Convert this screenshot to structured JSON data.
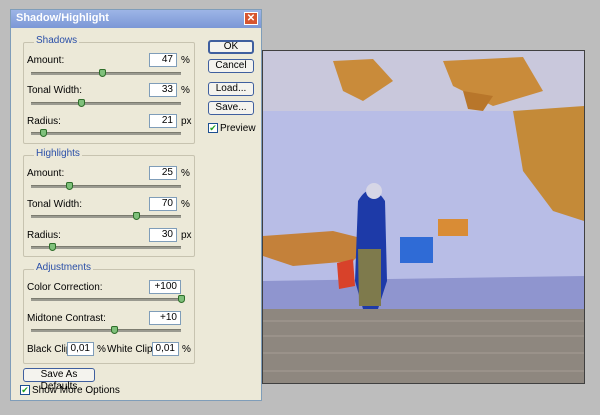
{
  "dialog": {
    "title": "Shadow/Highlight",
    "close_glyph": "✕"
  },
  "shadows": {
    "group_label": "Shadows",
    "amount": {
      "label": "Amount:",
      "value": "47",
      "unit": "%",
      "slider_fraction": 0.47
    },
    "tonal_width": {
      "label": "Tonal Width:",
      "value": "33",
      "unit": "%",
      "slider_fraction": 0.33
    },
    "radius": {
      "label": "Radius:",
      "value": "21",
      "unit": "px",
      "slider_fraction": 0.08
    }
  },
  "highlights": {
    "group_label": "Highlights",
    "amount": {
      "label": "Amount:",
      "value": "25",
      "unit": "%",
      "slider_fraction": 0.25
    },
    "tonal_width": {
      "label": "Tonal Width:",
      "value": "70",
      "unit": "%",
      "slider_fraction": 0.7
    },
    "radius": {
      "label": "Radius:",
      "value": "30",
      "unit": "px",
      "slider_fraction": 0.14
    }
  },
  "adjustments": {
    "group_label": "Adjustments",
    "color_correction": {
      "label": "Color Correction:",
      "value": "+100",
      "slider_fraction": 1.0
    },
    "midtone_contrast": {
      "label": "Midtone Contrast:",
      "value": "+10",
      "slider_fraction": 0.55
    },
    "black_clip": {
      "label": "Black Clip:",
      "value": "0,01",
      "unit": "%"
    },
    "white_clip": {
      "label": "White Clip:",
      "value": "0,01",
      "unit": "%"
    }
  },
  "buttons": {
    "ok": "OK",
    "cancel": "Cancel",
    "load": "Load...",
    "save": "Save...",
    "save_defaults": "Save As Defaults"
  },
  "checkboxes": {
    "preview": {
      "label": "Preview",
      "checked": true
    },
    "show_more": {
      "label": "Show More Options",
      "checked": true
    }
  },
  "colors": {
    "group_label": "#2a4fa8",
    "title_bar": "#7b97d6",
    "slider_thumb": "#7fc07b"
  }
}
